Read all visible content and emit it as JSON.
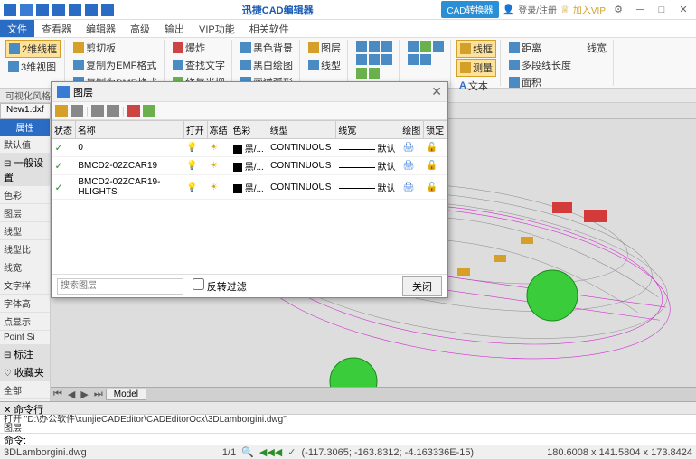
{
  "titlebar": {
    "title": "迅捷CAD编辑器",
    "cad_convert": "CAD转换器",
    "login": "登录/注册",
    "vip": "加入VIP"
  },
  "menu": {
    "file": "文件",
    "viewer": "查看器",
    "editor": "编辑器",
    "advanced": "高级",
    "output": "输出",
    "vip": "VIP功能",
    "related": "相关软件"
  },
  "ribbon": {
    "wireframe2d": "2维线框",
    "view3d": "3维视图",
    "clip": "剪切板",
    "emf": "复制为EMF格式",
    "bmp": "复制为BMP格式",
    "explode": "爆炸",
    "findtext": "查找文字",
    "repair": "修复光栅",
    "blackbg": "黑色背景",
    "bwdraw": "黑白绘图",
    "arc": "画谱弧形",
    "layer": "图层",
    "linetype": "线型",
    "wireframe": "线框",
    "measure": "测量",
    "text_a": "文本",
    "distance": "距离",
    "polylen": "多段线长度",
    "area": "面积",
    "lineweight": "线宽"
  },
  "subhead": "可视化风格",
  "filetab": "New1.dxf",
  "sidebar": {
    "tab_attr": "属性",
    "tab_other": "",
    "defaults": "默认值",
    "general": "一般设置",
    "items": [
      "色彩",
      "图层",
      "线型",
      "线型比",
      "线宽",
      "文字样",
      "字体高",
      "点显示",
      "Point Si"
    ],
    "annotation": "标注",
    "favorites": "收藏夹",
    "all": "全部"
  },
  "dialog": {
    "title": "图层",
    "cols": {
      "state": "状态",
      "name": "名称",
      "open": "打开",
      "freeze": "冻结",
      "color": "色彩",
      "ltype": "线型",
      "lweight": "线宽",
      "plot": "绘图",
      "lock": "锁定"
    },
    "rows": [
      {
        "name": "0",
        "color": "黑/...",
        "ltype": "CONTINUOUS",
        "lweight": "默认"
      },
      {
        "name": "BMCD2-02ZCAR19",
        "color": "黑/...",
        "ltype": "CONTINUOUS",
        "lweight": "默认"
      },
      {
        "name": "BMCD2-02ZCAR19-HLIGHTS",
        "color": "黑/...",
        "ltype": "CONTINUOUS",
        "lweight": "默认"
      }
    ],
    "search_ph": "搜索图层",
    "invert": "反转过滤",
    "close": "关闭"
  },
  "canvas": {
    "model_tab": "Model"
  },
  "cmd": {
    "title": "命令行",
    "log": "打开 \"D:\\办公软件\\xunjieCADEditor\\CADEditorOcx\\3DLamborgini.dwg\"\n图层",
    "prompt": "命令:"
  },
  "status": {
    "file": "3DLamborgini.dwg",
    "pages": "1/1",
    "coords": "(-117.3065; -163.8312; -4.163336E-15)",
    "size": "180.6008 x 141.5804 x 173.8424"
  }
}
